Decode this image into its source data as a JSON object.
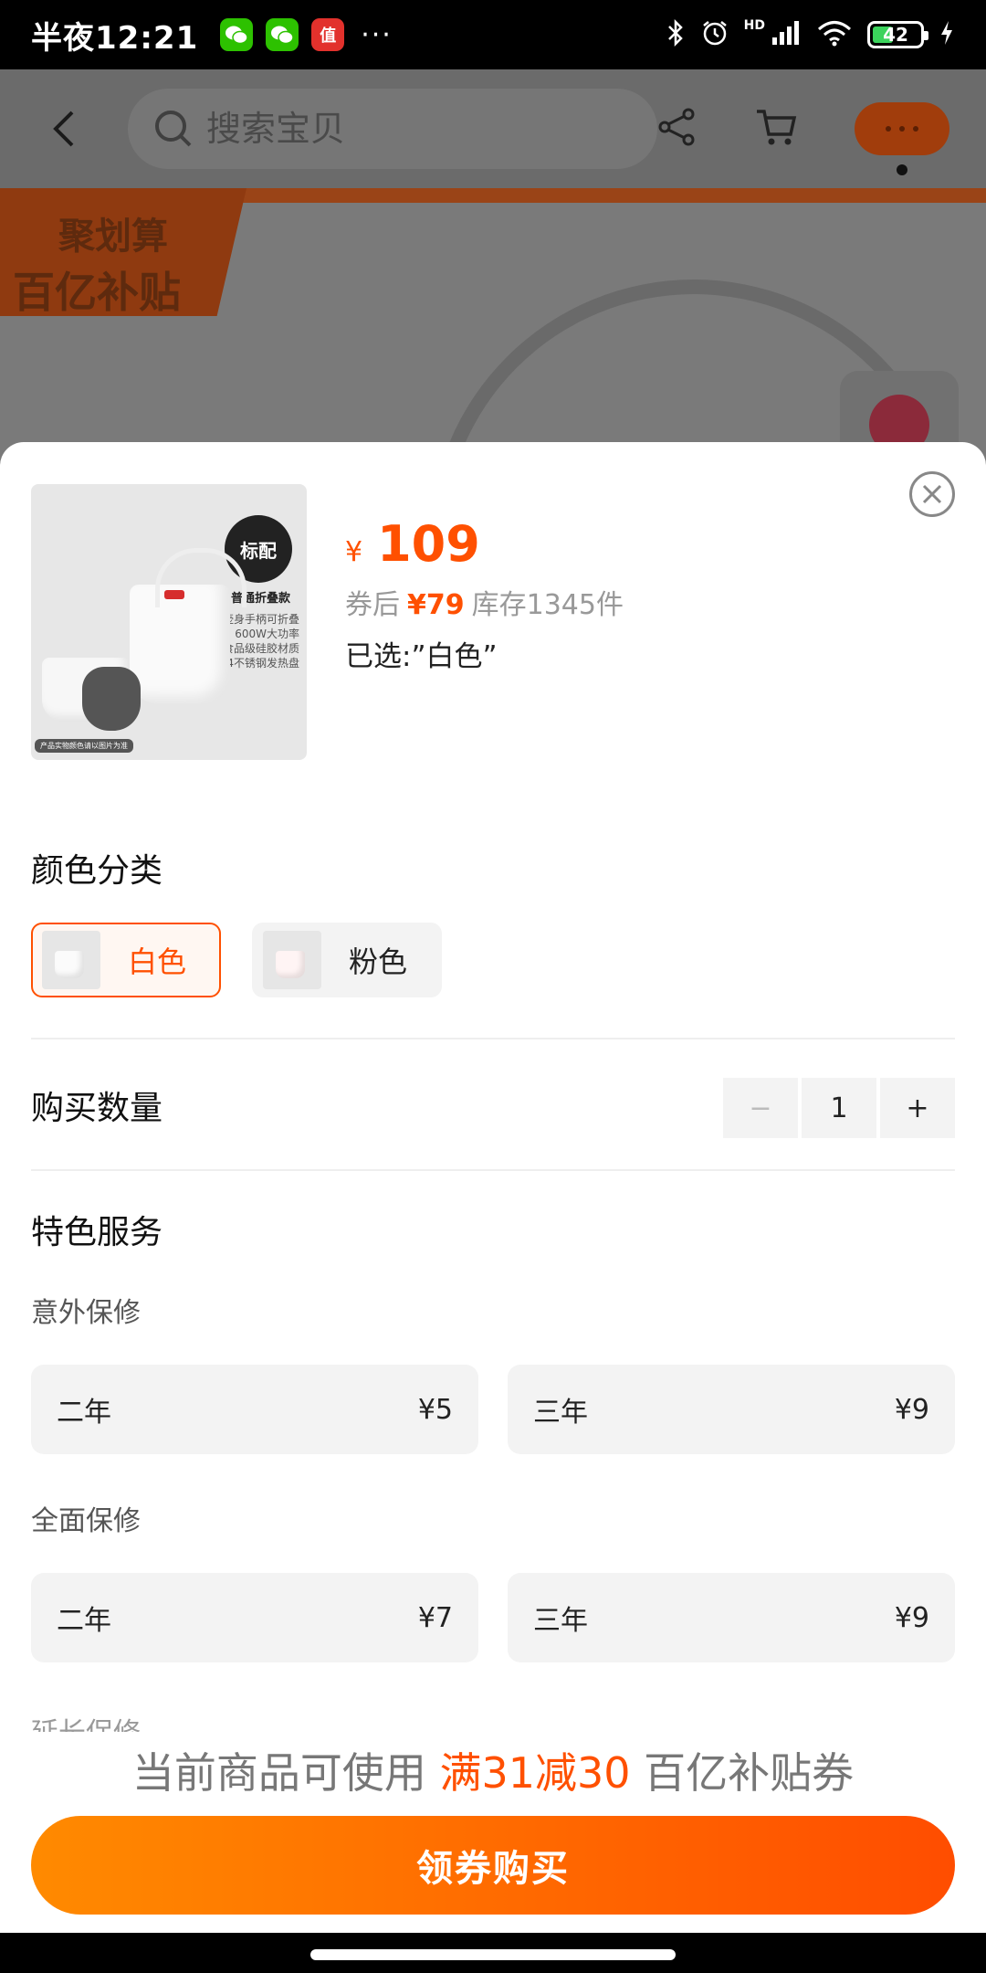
{
  "status_bar": {
    "time": "半夜12:21",
    "apps": [
      "wechat-icon",
      "wechat-icon",
      "值"
    ],
    "more": "···",
    "hd": "HD",
    "battery": "42"
  },
  "header": {
    "search_placeholder": "搜索宝贝"
  },
  "banner": {
    "line1": "聚划算",
    "line2": "百亿补贴"
  },
  "product": {
    "badge": "标配",
    "title": "普通折叠款",
    "lines": [
      "壶身手柄可折叠",
      "600W大功率",
      "食品级硅胶材质",
      "304不锈钢发热盘"
    ],
    "caption": "产品实物颜色请以图片为准",
    "price_symbol": "¥",
    "price": "109",
    "after_coupon_label": "券后",
    "after_coupon_price": "¥79",
    "stock": "库存1345件",
    "selected": "已选:”白色”"
  },
  "color_section": {
    "title": "颜色分类",
    "options": [
      {
        "label": "白色",
        "selected": true
      },
      {
        "label": "粉色",
        "selected": false
      }
    ]
  },
  "quantity": {
    "title": "购买数量",
    "minus": "−",
    "value": "1",
    "plus": "+"
  },
  "services": {
    "title": "特色服务",
    "groups": [
      {
        "title": "意外保修",
        "items": [
          {
            "term": "二年",
            "price": "¥5"
          },
          {
            "term": "三年",
            "price": "¥9"
          }
        ]
      },
      {
        "title": "全面保修",
        "items": [
          {
            "term": "二年",
            "price": "¥7"
          },
          {
            "term": "三年",
            "price": "¥9"
          }
        ]
      }
    ],
    "truncated_next": "延长保修"
  },
  "promo": {
    "prefix": "当前商品可使用",
    "highlight": "满31减30",
    "suffix": "百亿补贴券"
  },
  "buy_button": "领券购买",
  "colors": {
    "accent": "#ff5000",
    "button_start": "#ff8a00",
    "button_end": "#ff4d00"
  }
}
